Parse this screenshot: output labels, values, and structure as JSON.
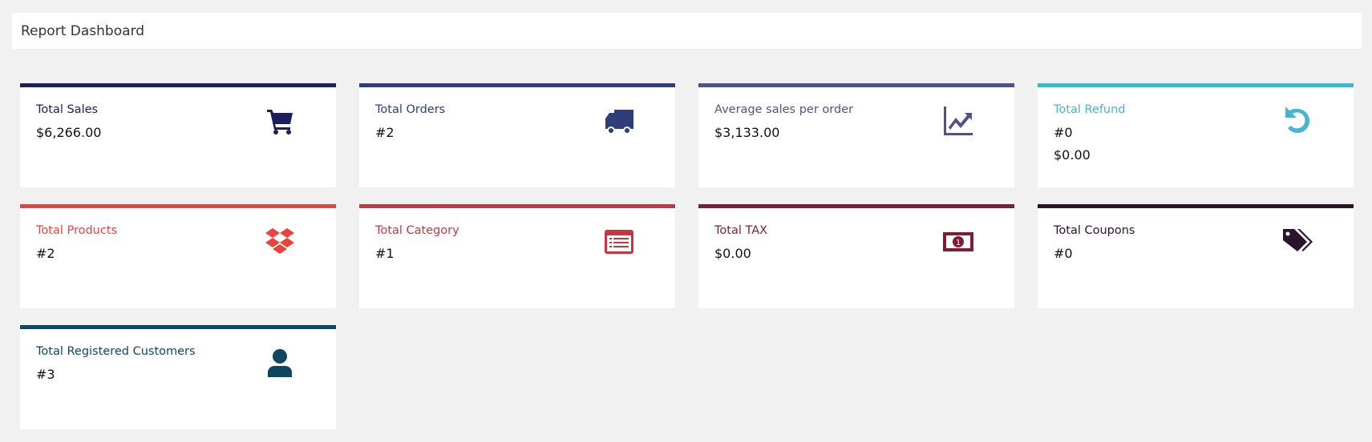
{
  "header": {
    "title": "Report Dashboard"
  },
  "cards": [
    {
      "title": "Total Sales",
      "values": [
        "$6,266.00"
      ],
      "color": "#1b1f5f",
      "icon": "shopping-cart-icon"
    },
    {
      "title": "Total Orders",
      "values": [
        "#2"
      ],
      "color": "#2f3d78",
      "icon": "truck-icon"
    },
    {
      "title": "Average sales per order",
      "values": [
        "$3,133.00"
      ],
      "color": "#4e5285",
      "icon": "line-chart-icon"
    },
    {
      "title": "Total Refund",
      "values": [
        "#0",
        "$0.00"
      ],
      "color": "#45b5d2",
      "icon": "undo-icon"
    },
    {
      "title": "Total Products",
      "values": [
        "#2"
      ],
      "color": "#e9433b",
      "icon": "dropbox-icon"
    },
    {
      "title": "Total Category",
      "values": [
        "#1"
      ],
      "color": "#c8353f",
      "icon": "list-alt-icon"
    },
    {
      "title": "Total TAX",
      "values": [
        "$0.00"
      ],
      "color": "#7e1d34",
      "icon": "money-icon"
    },
    {
      "title": "Total Coupons",
      "values": [
        "#0"
      ],
      "color": "#2b1329",
      "icon": "tags-icon"
    },
    {
      "title": "Total Registered Customers",
      "values": [
        "#3"
      ],
      "color": "#0f4661",
      "icon": "user-icon"
    }
  ]
}
